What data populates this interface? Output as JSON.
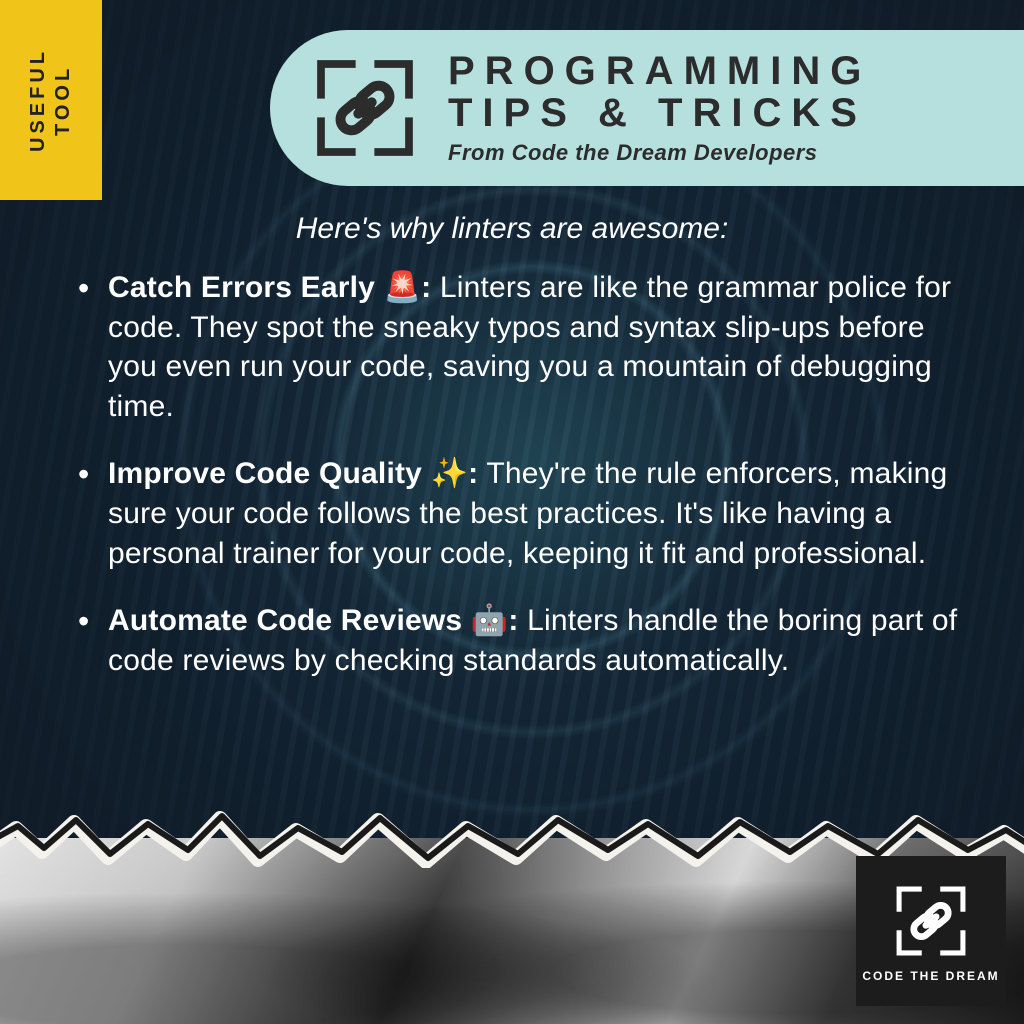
{
  "tag": {
    "line1": "USEFUL",
    "line2": "TOOL"
  },
  "header": {
    "title_line1": "PROGRAMMING",
    "title_line2": "TIPS & TRICKS",
    "subtitle": "From Code the Dream Developers"
  },
  "intro": "Here's why linters are awesome:",
  "bullets": [
    {
      "lead": "Catch Errors Early 🚨:",
      "body": " Linters are like the grammar police for code. They spot the sneaky typos and syntax slip-ups before you even run your code, saving you a mountain of debugging time."
    },
    {
      "lead": "Improve Code Quality ✨:",
      "body": " They're the rule enforcers, making sure your code follows the best practices. It's like having a personal trainer for your code, keeping it fit and professional."
    },
    {
      "lead": "Automate Code Reviews 🤖:",
      "body": " Linters handle the boring part of code reviews by checking standards automatically."
    }
  ],
  "brand": {
    "name": "CODE THE DREAM"
  }
}
